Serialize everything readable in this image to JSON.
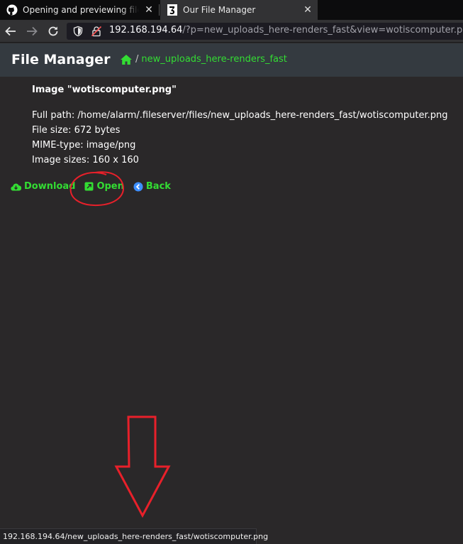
{
  "browser": {
    "tabs": [
      {
        "title": "Opening and previewing files n",
        "icon": "github-icon"
      },
      {
        "title": "Our File Manager",
        "icon": "site-favicon"
      }
    ],
    "url_host": "192.168.194.64",
    "url_rest": "/?p=new_uploads_here-renders_fast&view=wotiscomputer.png",
    "status_url": "192.168.194.64/new_uploads_here-renders_fast/wotiscomputer.png"
  },
  "header": {
    "brand": "File Manager",
    "separator": "/",
    "folder": "new_uploads_here-renders_fast"
  },
  "file": {
    "title": "Image \"wotiscomputer.png\"",
    "full_path": "Full path: /home/alarm/.fileserver/files/new_uploads_here-renders_fast/wotiscomputer.png",
    "file_size": "File size: 672 bytes",
    "mime_type": "MIME-type: image/png",
    "image_sizes": "Image sizes: 160 x 160"
  },
  "actions": {
    "download": "Download",
    "open": "Open",
    "back": "Back"
  },
  "colors": {
    "accent": "#33dd33",
    "annotation": "#e8202a",
    "background": "#2a2829",
    "header": "#343a40"
  }
}
